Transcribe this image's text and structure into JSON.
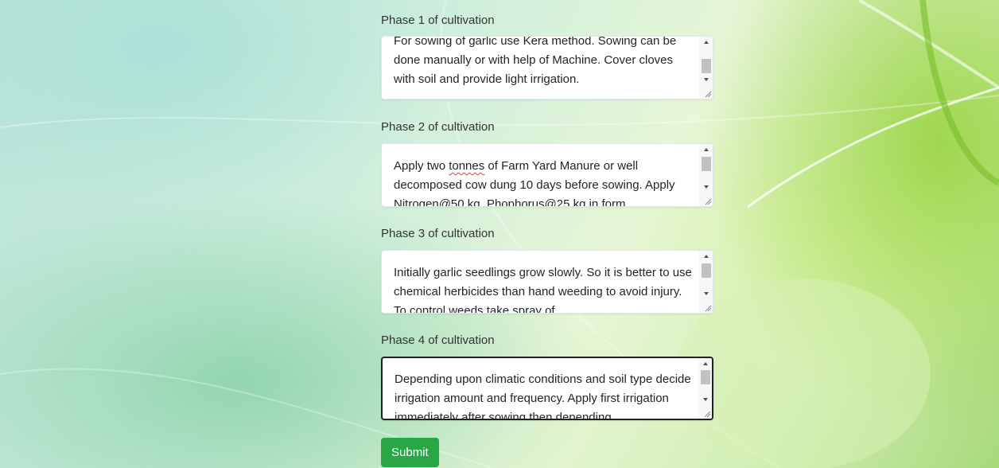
{
  "theme": {
    "submit_color": "#28a745",
    "focus_border": "#222222"
  },
  "form": {
    "phases": [
      {
        "label": "Phase 1 of cultivation",
        "text": "For sowing of garlic use Kera method. Sowing can be done manually or with help of Machine. Cover cloves with soil and provide light irrigation."
      },
      {
        "label": "Phase 2 of cultivation",
        "text": "Apply two tonnes of Farm Yard Manure or well decomposed cow dung 10 days before sowing. Apply Nitrogen@50 kg, Phophorus@25 kg in form"
      },
      {
        "label": "Phase 3 of cultivation",
        "text": "Initially garlic seedlings grow slowly. So it is better to use chemical herbicides than hand weeding to avoid injury. To control weeds take spray of"
      },
      {
        "label": "Phase 4 of cultivation",
        "text": "Depending upon climatic conditions and soil type decide irrigation amount and frequency. Apply first irrigation immediately after sowing then depending"
      }
    ],
    "submit_label": "Submit"
  }
}
